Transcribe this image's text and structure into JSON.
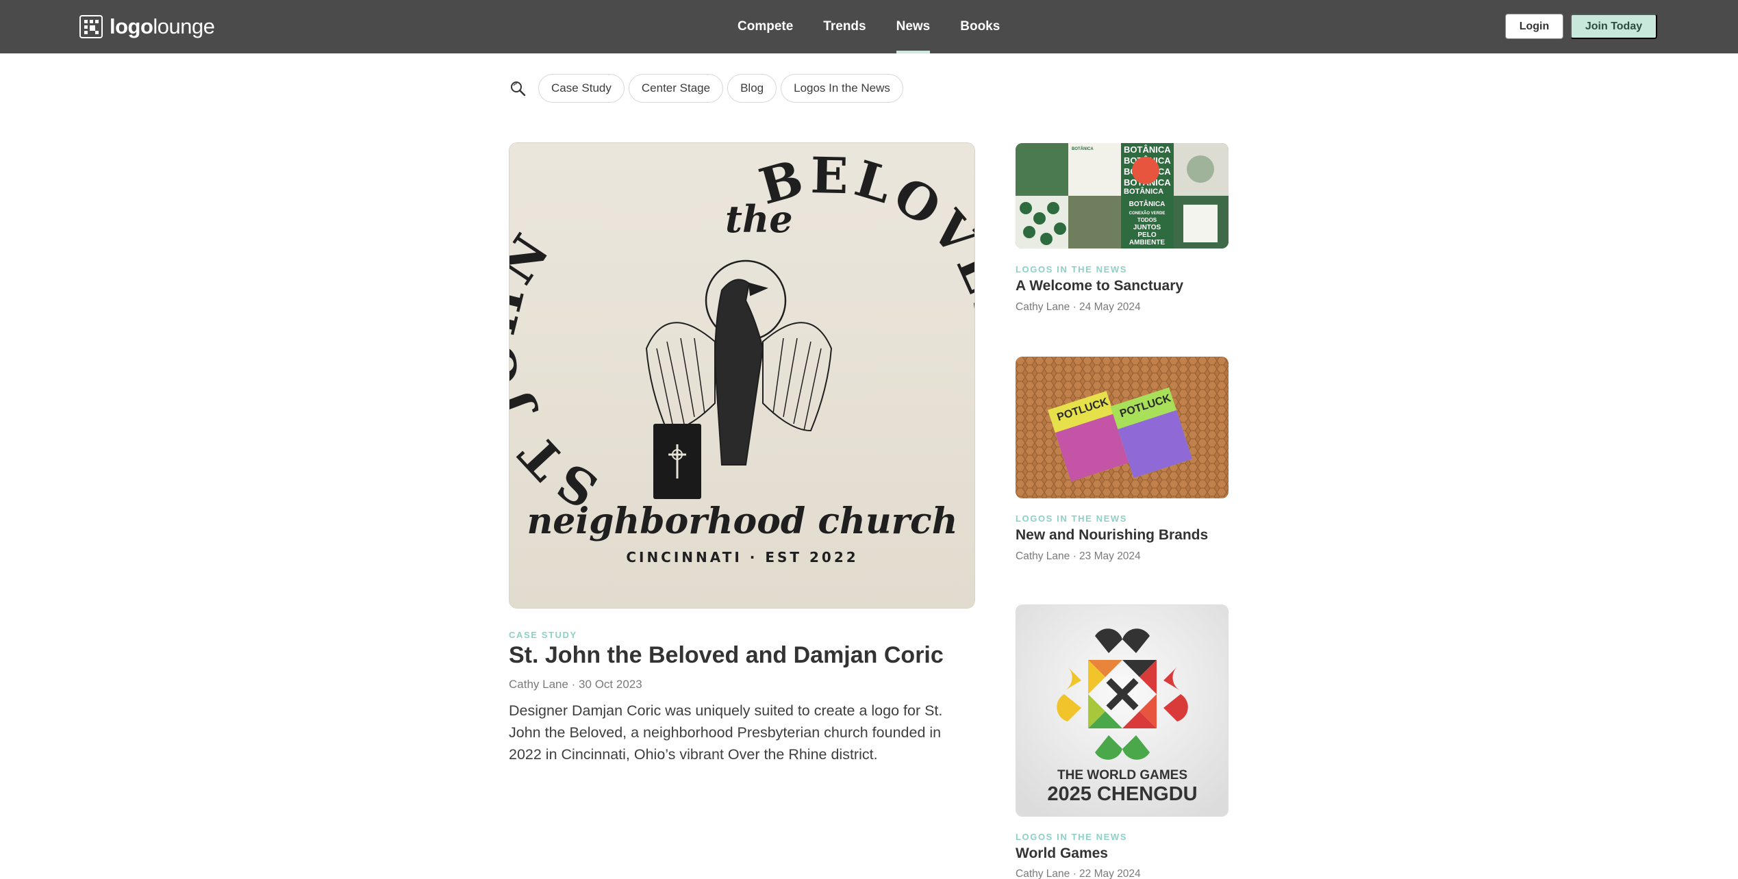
{
  "header": {
    "brand_bold": "logo",
    "brand_light": "lounge",
    "nav": [
      {
        "label": "Compete"
      },
      {
        "label": "Trends"
      },
      {
        "label": "News"
      },
      {
        "label": "Books"
      }
    ],
    "active_nav": "News",
    "login_label": "Login",
    "join_label": "Join Today"
  },
  "filters": {
    "chips": [
      "Case Study",
      "Center Stage",
      "Blog",
      "Logos In the News"
    ]
  },
  "featured": {
    "category": "CASE STUDY",
    "title": "St. John the Beloved and Damjan Coric",
    "author": "Cathy Lane",
    "date": "30 Oct 2023",
    "meta": "Cathy Lane · 30 Oct 2023",
    "description": "Designer Damjan Coric was uniquely suited to create a logo for St. John the Beloved, a neighborhood Presbyterian church founded in 2022 in Cincinnati, Ohio’s vibrant Over the Rhine district.",
    "image": {
      "arc_left": "ST JOHN",
      "arc_right": "BELOVED",
      "the_script": "the",
      "script_line": "neighborhood church",
      "location_line": "CINCINNATI · EST 2022"
    }
  },
  "side_articles": [
    {
      "category": "LOGOS IN THE NEWS",
      "title": "A Welcome to Sanctuary",
      "meta": "Cathy Lane · 24 May 2024",
      "image_text": {
        "word": "BOTÂNICA",
        "small": "BOTÂNICA",
        "tagline": "CONEXÃO VERDE",
        "slogan_1": "TODOS",
        "slogan_2": "JUNTOS",
        "slogan_3": "PELO",
        "slogan_4": "AMBIENTE"
      }
    },
    {
      "category": "LOGOS IN THE NEWS",
      "title": "New and Nourishing Brands",
      "meta": "Cathy Lane · 23 May 2024",
      "image_text": {
        "box_1": "POTLUCK",
        "box_2": "POTLUCK"
      }
    },
    {
      "category": "LOGOS IN THE NEWS",
      "title": "World Games",
      "meta": "Cathy Lane · 22 May 2024",
      "image_text": {
        "line_1": "THE WORLD GAMES",
        "line_2": "2025 CHENGDU"
      }
    }
  ],
  "colors": {
    "header_bg": "#4b4b4b",
    "accent_mint": "#c9e8dc",
    "kicker": "#8ed0c6",
    "text_dark": "#333333",
    "text_meta": "#7a7a7a"
  }
}
